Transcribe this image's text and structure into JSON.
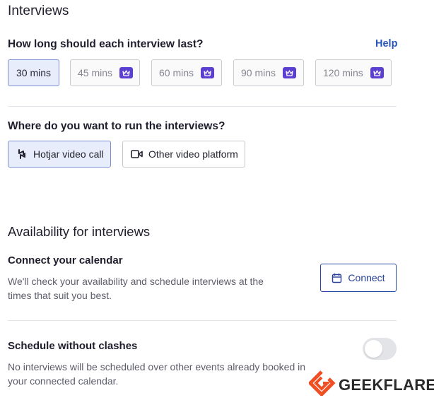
{
  "section_title": "Interviews",
  "duration": {
    "question": "How long should each interview last?",
    "help_label": "Help",
    "options": [
      {
        "label": "30 mins",
        "selected": true,
        "premium": false
      },
      {
        "label": "45 mins",
        "selected": false,
        "premium": true
      },
      {
        "label": "60 mins",
        "selected": false,
        "premium": true
      },
      {
        "label": "90 mins",
        "selected": false,
        "premium": true
      },
      {
        "label": "120 mins",
        "selected": false,
        "premium": true
      }
    ]
  },
  "platform": {
    "question": "Where do you want to run the interviews?",
    "options": [
      {
        "label": "Hotjar video call",
        "icon": "hotjar-icon",
        "selected": true
      },
      {
        "label": "Other video platform",
        "icon": "video-camera-icon",
        "selected": false
      }
    ]
  },
  "availability": {
    "title": "Availability for interviews",
    "calendar": {
      "title": "Connect your calendar",
      "description_line1": "We'll check your availability and schedule interviews at the",
      "description_line2": "times that suit you best.",
      "connect_label": "Connect",
      "connect_icon": "calendar-icon"
    },
    "clashes": {
      "title": "Schedule without clashes",
      "description_line1": "No interviews will be scheduled over other events already booked in",
      "description_line2": "your connected calendar.",
      "toggle_on": false
    }
  },
  "watermark": {
    "text": "GEEKFLARE",
    "color": "#f04e23"
  },
  "colors": {
    "accent": "#2755b8",
    "selected_bg": "#e8edfb",
    "premium_badge": "#5b3fd0"
  }
}
